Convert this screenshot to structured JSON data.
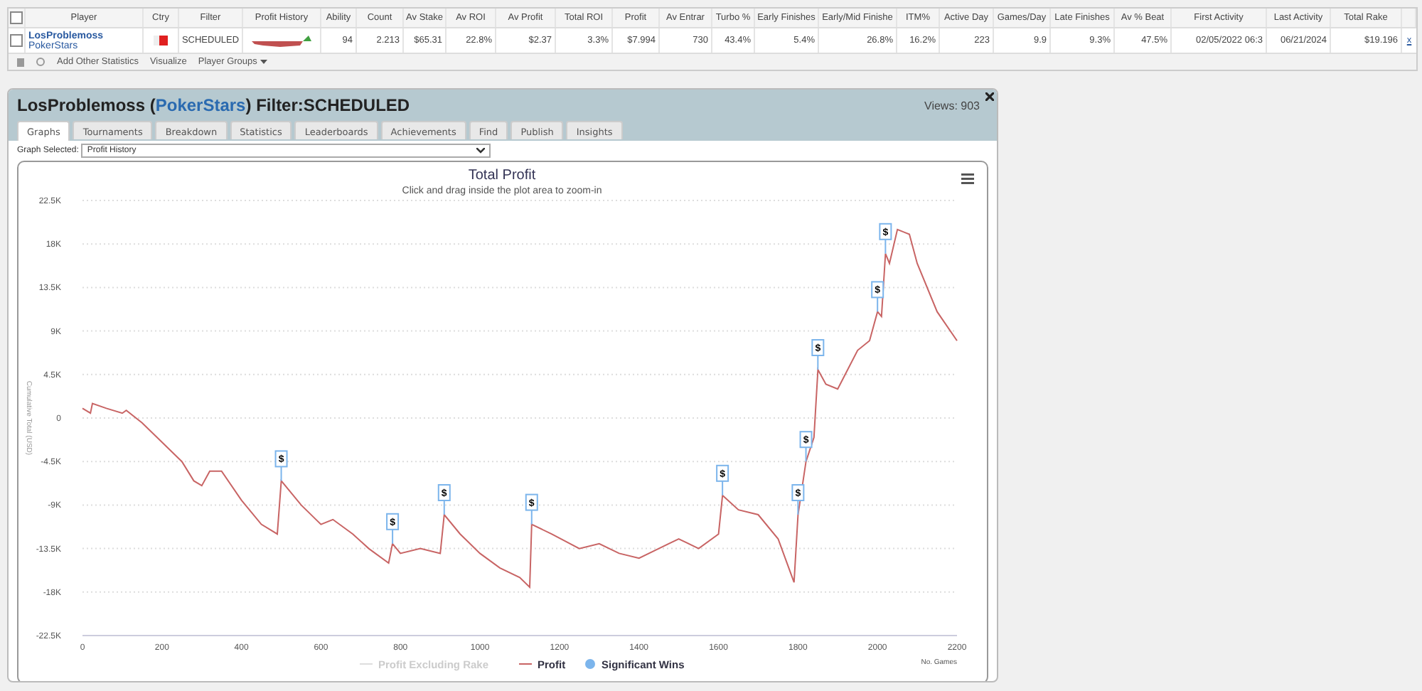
{
  "stats_table": {
    "all_checked": false,
    "columns": [
      "Player",
      "Ctry",
      "Filter",
      "Profit History",
      "Ability",
      "Count",
      "Av Stake",
      "Av ROI",
      "Av Profit",
      "Total ROI",
      "Profit",
      "Av Entrar",
      "Turbo %",
      "Early Finishes",
      "Early/Mid Finishe",
      "ITM%",
      "Active Day",
      "Games/Day",
      "Late Finishes",
      "Av % Beat",
      "First Activity",
      "Last Activity",
      "Total Rake"
    ],
    "row": {
      "checked": false,
      "player": "LosProblemoss",
      "network": "PokerStars",
      "filter": "SCHEDULED",
      "cells": [
        "94",
        "2.213",
        "$65.31",
        "22.8%",
        "$2.37",
        "3.3%",
        "$7.994",
        "730",
        "43.4%",
        "5.4%",
        "26.8%",
        "16.2%",
        "223",
        "9.9",
        "9.3%",
        "47.5%",
        "02/05/2022 06:3",
        "06/21/2024",
        "$19.196"
      ],
      "remove": "x"
    },
    "toolbar": [
      "Add Other Statistics",
      "Visualize",
      "Player Groups"
    ]
  },
  "panel": {
    "title_prefix": "LosProblemoss (",
    "network": "PokerStars",
    "title_suffix": ") Filter:SCHEDULED",
    "views": "Views: 903",
    "tabs": [
      {
        "label": "Graphs",
        "selected": true
      },
      {
        "label": "Tournaments",
        "selected": false
      },
      {
        "label": "Breakdown",
        "selected": false
      },
      {
        "label": "Statistics",
        "selected": false
      },
      {
        "label": "Leaderboards",
        "selected": false
      },
      {
        "label": "Achievements",
        "selected": false
      },
      {
        "label": "Find",
        "selected": false
      },
      {
        "label": "Publish",
        "selected": false
      },
      {
        "label": "Insights",
        "selected": false
      }
    ],
    "graph_select": {
      "label": "Graph Selected:",
      "value": "Profit History"
    },
    "legend": [
      {
        "label": "Profit Excluding Rake",
        "enabled": false
      },
      {
        "label": "Significant Wins",
        "enabled": true,
        "color": "#7cb5ec"
      }
    ],
    "chart_data": {
      "type": "line",
      "title": "Total Profit",
      "subtitle": "Click and drag inside the plot area to zoom-in",
      "xlabel": "No. Games",
      "ylabel": "Cumulative Total (USD)",
      "grid": true,
      "xlim": [
        0,
        2200
      ],
      "ylim": [
        -22500,
        22500
      ],
      "xticks": [
        0,
        200,
        400,
        600,
        800,
        1000,
        1200,
        1400,
        1600,
        1800,
        2000,
        2200
      ],
      "yticks": [
        {
          "value": 22500,
          "label": "22.5K"
        },
        {
          "value": 18000,
          "label": "18K"
        },
        {
          "value": 13500,
          "label": "13.5K"
        },
        {
          "value": 9000,
          "label": "9K"
        },
        {
          "value": 4500,
          "label": "4.5K"
        },
        {
          "value": 0,
          "label": "0"
        },
        {
          "value": -4500,
          "label": "-4.5K"
        },
        {
          "value": -9000,
          "label": "-9K"
        },
        {
          "value": -13500,
          "label": "-13.5K"
        },
        {
          "value": -18000,
          "label": "-18K"
        },
        {
          "value": -22500,
          "label": "-22.5K"
        }
      ],
      "x": [
        0,
        20,
        25,
        60,
        100,
        110,
        150,
        200,
        250,
        280,
        300,
        320,
        350,
        400,
        450,
        490,
        500,
        550,
        600,
        630,
        680,
        720,
        770,
        780,
        800,
        850,
        900,
        910,
        950,
        1000,
        1050,
        1100,
        1125,
        1130,
        1180,
        1250,
        1300,
        1350,
        1400,
        1450,
        1500,
        1550,
        1600,
        1610,
        1650,
        1700,
        1750,
        1790,
        1800,
        1820,
        1840,
        1850,
        1870,
        1900,
        1950,
        1980,
        2000,
        2010,
        2020,
        2030,
        2050,
        2080,
        2100,
        2150,
        2200
      ],
      "series": [
        {
          "name": "Profit",
          "color": "#c86464",
          "values": [
            1000,
            500,
            1500,
            1000,
            500,
            800,
            -500,
            -2500,
            -4500,
            -6500,
            -7000,
            -5500,
            -5500,
            -8500,
            -11000,
            -12000,
            -6500,
            -9000,
            -11000,
            -10500,
            -12000,
            -13500,
            -15000,
            -13000,
            -14000,
            -13500,
            -14000,
            -10000,
            -12000,
            -14000,
            -15500,
            -16500,
            -17500,
            -11000,
            -12000,
            -13500,
            -13000,
            -14000,
            -14500,
            -13500,
            -12500,
            -13500,
            -12000,
            -8000,
            -9500,
            -10000,
            -12500,
            -17000,
            -10000,
            -4500,
            -2000,
            5000,
            3500,
            3000,
            7000,
            8000,
            11000,
            10500,
            17000,
            16000,
            19500,
            19000,
            16000,
            11000,
            8000
          ]
        }
      ],
      "annotations": [
        {
          "x": 500,
          "y": -6500,
          "text": "$"
        },
        {
          "x": 780,
          "y": -13000,
          "text": "$"
        },
        {
          "x": 910,
          "y": -10000,
          "text": "$"
        },
        {
          "x": 1130,
          "y": -11000,
          "text": "$"
        },
        {
          "x": 1610,
          "y": -8000,
          "text": "$"
        },
        {
          "x": 1800,
          "y": -10000,
          "text": "$"
        },
        {
          "x": 1820,
          "y": -4500,
          "text": "$"
        },
        {
          "x": 1850,
          "y": 5000,
          "text": "$"
        },
        {
          "x": 2000,
          "y": 11000,
          "text": "$"
        },
        {
          "x": 2020,
          "y": 17000,
          "text": "$"
        }
      ]
    }
  }
}
